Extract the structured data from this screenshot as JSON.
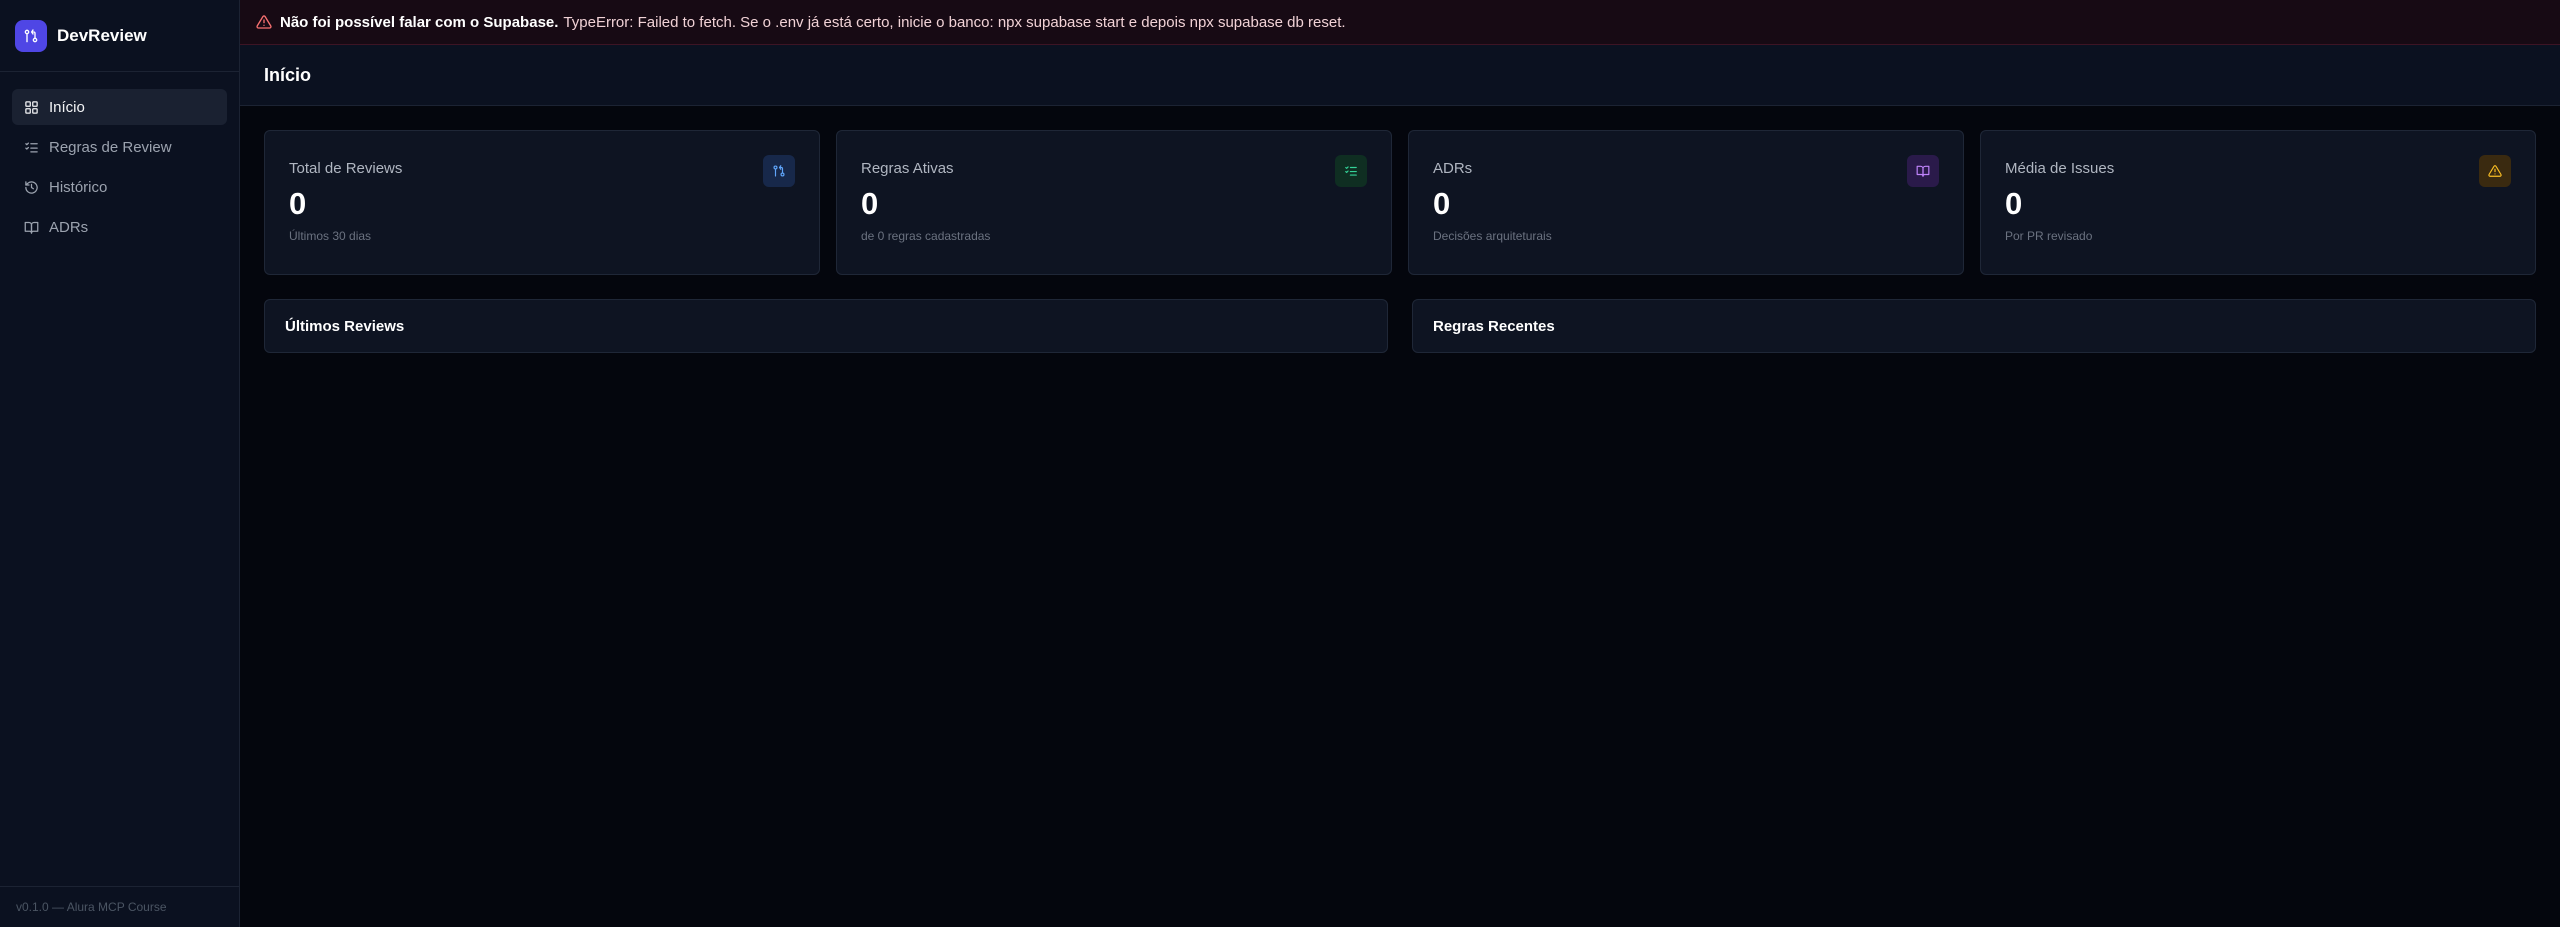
{
  "brand": {
    "name": "DevReview",
    "icon": "git-pull-request-icon",
    "color": "#4f46e5"
  },
  "sidebar": {
    "items": [
      {
        "label": "Início",
        "icon": "layout-grid-icon",
        "active": true
      },
      {
        "label": "Regras de Review",
        "icon": "list-checks-icon",
        "active": false
      },
      {
        "label": "Histórico",
        "icon": "history-icon",
        "active": false
      },
      {
        "label": "ADRs",
        "icon": "book-open-icon",
        "active": false
      }
    ],
    "footer": "v0.1.0 — Alura MCP Course"
  },
  "alert": {
    "icon": "warning-triangle-icon",
    "title": "Não foi possível falar com o Supabase.",
    "message": "TypeError: Failed to fetch. Se o .env já está certo, inicie o banco: npx supabase start e depois npx supabase db reset.",
    "color": "#f87171"
  },
  "header": {
    "title": "Início"
  },
  "stats": [
    {
      "label": "Total de Reviews",
      "value": "0",
      "sub": "Últimos 30 dias",
      "icon": "git-pull-request-icon",
      "color": "#60a5fa"
    },
    {
      "label": "Regras Ativas",
      "value": "0",
      "sub": "de 0 regras cadastradas",
      "icon": "list-checks-icon",
      "color": "#34d399"
    },
    {
      "label": "ADRs",
      "value": "0",
      "sub": "Decisões arquiteturais",
      "icon": "book-open-icon",
      "color": "#c084fc"
    },
    {
      "label": "Média de Issues",
      "value": "0",
      "sub": "Por PR revisado",
      "icon": "warning-triangle-icon",
      "color": "#fbbf24"
    }
  ],
  "panels": {
    "latest_reviews": {
      "title": "Últimos Reviews"
    },
    "recent_rules": {
      "title": "Regras Recentes"
    }
  }
}
